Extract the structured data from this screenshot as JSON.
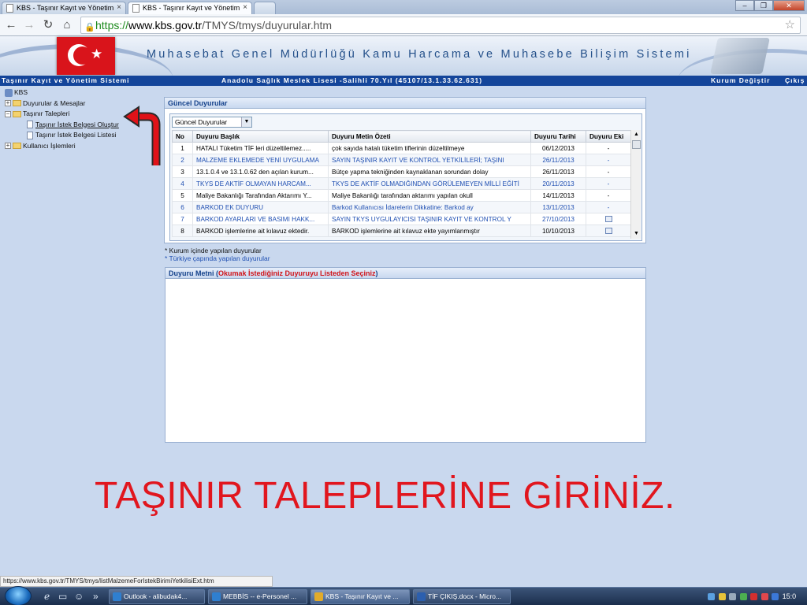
{
  "browser": {
    "tabs": [
      {
        "label": "KBS - Taşınır Kayıt ve Yönetim",
        "active": false
      },
      {
        "label": "KBS - Taşınır Kayıt ve Yönetim",
        "active": true
      }
    ],
    "url_scheme": "https://",
    "url_host": "www.kbs.gov.tr",
    "url_path": "/TMYS/tmys/duyurular.htm"
  },
  "banner": {
    "title": "Muhasebat Genel Müdürlüğü Kamu Harcama ve Muhasebe Bilişim Sistemi"
  },
  "infobar": {
    "system_name": "Taşınır Kayıt ve Yönetim Sistemi",
    "institution": "Anadolu Sağlık Meslek Lisesi -Salihli 70.Yıl (45107/13.1.33.62.631)",
    "change_org": "Kurum Değiştir",
    "logout": "Çıkış"
  },
  "tree": {
    "root": "KBS",
    "items": [
      {
        "label": "Duyurular & Mesajlar",
        "expander": "+"
      },
      {
        "label": "Taşınır Talepleri",
        "expander": "−"
      },
      {
        "label": "Taşınır İstek Belgesi Oluştur"
      },
      {
        "label": "Taşınır İstek Belgesi Listesi"
      },
      {
        "label": "Kullanıcı İşlemleri",
        "expander": "+"
      }
    ]
  },
  "announcements": {
    "panel_title": "Güncel Duyurular",
    "filter_selected": "Güncel Duyurular",
    "columns": [
      "No",
      "Duyuru Başlık",
      "Duyuru Metin Özeti",
      "Duyuru Tarihi",
      "Duyuru Eki"
    ],
    "rows": [
      {
        "no": "1",
        "title": "HATALI Tüketim TİF leri düzeltilemez.....",
        "summary": "çok sayıda hatalı tüketim tiflerinin düzeltilmeye",
        "date": "06/12/2013",
        "attachment": "-",
        "blue": false
      },
      {
        "no": "2",
        "title": "MALZEME EKLEMEDE YENİ UYGULAMA",
        "summary": "SAYIN TAŞINIR KAYIT VE KONTROL YETKİLİLERİ; TAŞINI",
        "date": "26/11/2013",
        "attachment": "-",
        "blue": true
      },
      {
        "no": "3",
        "title": "13.1.0.4 ve 13.1.0.62 den açılan kurum...",
        "summary": "Bütçe yapma tekniğinden kaynaklanan sorundan dolay",
        "date": "26/11/2013",
        "attachment": "-",
        "blue": false
      },
      {
        "no": "4",
        "title": "TKYS DE AKTİF OLMAYAN HARCAM...",
        "summary": "TKYS DE AKTİF OLMADIĞINDAN GÖRÜLEMEYEN MİLLİ EĞİTİ",
        "date": "20/11/2013",
        "attachment": "-",
        "blue": true
      },
      {
        "no": "5",
        "title": "Maliye Bakanlığı Tarafından Aktarımı Y...",
        "summary": "Maliye Bakanlığı tarafından aktarımı yapılan okull",
        "date": "14/11/2013",
        "attachment": "-",
        "blue": false
      },
      {
        "no": "6",
        "title": "BARKOD EK DUYURU",
        "summary": "Barkod Kullanıcısı İdarelerin Dikkatine: Barkod ay",
        "date": "13/11/2013",
        "attachment": "-",
        "blue": true
      },
      {
        "no": "7",
        "title": "BARKOD AYARLARI VE BASIMI HAKK...",
        "summary": "SAYIN TKYS UYGULAYICISI TAŞINIR KAYIT VE KONTROL Y",
        "date": "27/10/2013",
        "attachment": "icon",
        "blue": true
      },
      {
        "no": "8",
        "title": "BARKOD işlemlerine ait kılavuz ektedir.",
        "summary": "BARKOD işlemlerine ait kılavuz ekte yayımlanmıştır",
        "date": "10/10/2013",
        "attachment": "icon",
        "blue": false
      }
    ],
    "note_internal": "* Kurum içinde yapılan duyurular",
    "note_national": "* Türkiye çapında yapılan duyurular"
  },
  "detail": {
    "title_prefix": "Duyuru Metni (",
    "title_hint": "Okumak İstediğiniz Duyuruyu Listeden Seçiniz",
    "title_suffix": ")"
  },
  "instruction": "TAŞINIR TALEPLERİNE GİRİNİZ.",
  "statusbar": "https://www.kbs.gov.tr/TMYS/tmys/listMalzemeForIstekBirimiYetkilisiExt.htm",
  "taskbar": {
    "buttons": [
      {
        "label": "Outlook - alibudak4...",
        "active": false,
        "color": "#2f7fd0"
      },
      {
        "label": "MEBBİS -- e-Personel ...",
        "active": false,
        "color": "#2f7fd0"
      },
      {
        "label": "KBS - Taşınır Kayıt ve ...",
        "active": true,
        "color": "#e2ab2a"
      },
      {
        "label": "TİF ÇIKIŞ.docx - Micro...",
        "active": false,
        "color": "#2c5fae"
      }
    ],
    "clock": "15:0"
  },
  "colors": {
    "accent_blue": "#14459a",
    "instruction_red": "#e1161e",
    "link_blue": "#1f4fb2"
  }
}
